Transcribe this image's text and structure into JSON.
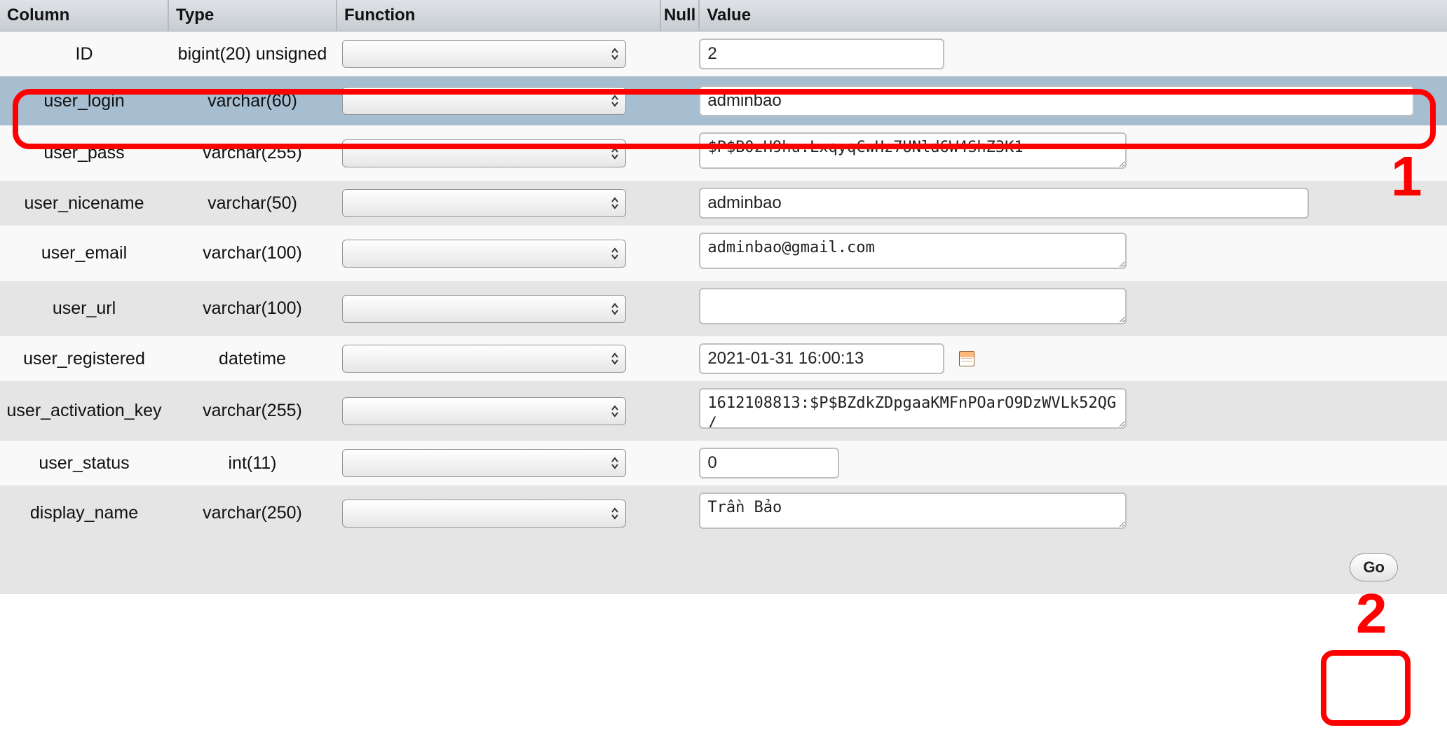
{
  "headers": {
    "column": "Column",
    "type": "Type",
    "function": "Function",
    "null": "Null",
    "value": "Value"
  },
  "rows": [
    {
      "column": "ID",
      "type": "bigint(20) unsigned",
      "input_kind": "text_short",
      "value": "2",
      "stripe": "odd"
    },
    {
      "column": "user_login",
      "type": "varchar(60)",
      "input_kind": "text_wide",
      "value": "adminbao",
      "stripe": "highlight"
    },
    {
      "column": "user_pass",
      "type": "varchar(255)",
      "input_kind": "textarea",
      "value": "$P$B0zH9hu.LxqyqCwHz7UNld6W4ShZ3K1",
      "stripe": "odd"
    },
    {
      "column": "user_nicename",
      "type": "varchar(50)",
      "input_kind": "text_mid",
      "value": "adminbao",
      "stripe": "even"
    },
    {
      "column": "user_email",
      "type": "varchar(100)",
      "input_kind": "textarea",
      "value": "adminbao@gmail.com",
      "stripe": "odd"
    },
    {
      "column": "user_url",
      "type": "varchar(100)",
      "input_kind": "textarea",
      "value": "",
      "stripe": "even"
    },
    {
      "column": "user_registered",
      "type": "datetime",
      "input_kind": "datetime",
      "value": "2021-01-31 16:00:13",
      "stripe": "odd"
    },
    {
      "column": "user_activation_key",
      "type": "varchar(255)",
      "input_kind": "textarea",
      "value": "1612108813:$P$BZdkZDpgaaKMFnPOarO9DzWVLk52QG/",
      "stripe": "even"
    },
    {
      "column": "user_status",
      "type": "int(11)",
      "input_kind": "text_short",
      "value": "0",
      "stripe": "odd"
    },
    {
      "column": "display_name",
      "type": "varchar(250)",
      "input_kind": "textarea",
      "value": "Trần Bảo",
      "stripe": "even"
    }
  ],
  "footer": {
    "go_label": "Go"
  },
  "annotations": {
    "label1": "1",
    "label2": "2"
  }
}
